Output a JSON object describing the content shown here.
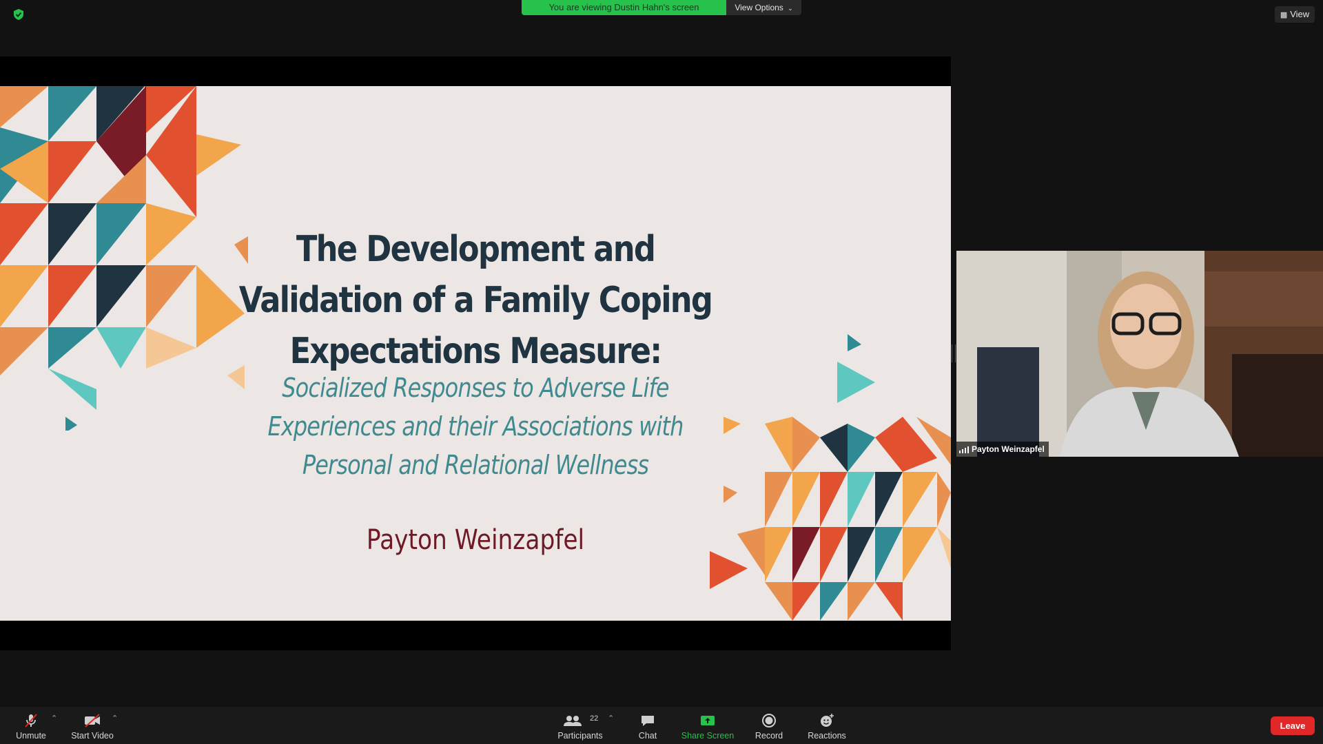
{
  "banner": {
    "text": "You are viewing Dustin Hahn's screen",
    "color": "#27c24c"
  },
  "view_options": {
    "label": "View Options",
    "icon": "chevron-down-icon"
  },
  "view_button": {
    "label": "View",
    "icon": "view-layout-icon"
  },
  "security": {
    "icon": "shield-check-icon",
    "color": "#27c24c"
  },
  "slide": {
    "title_lines": [
      "The Development and",
      "Validation of a Family Coping",
      "Expectations Measure:"
    ],
    "subtitle_lines": [
      "Socialized Responses to Adverse Life",
      "Experiences and their Associations with",
      "Personal and Relational Wellness"
    ],
    "author": "Payton Weinzapfel",
    "colors": {
      "background": "#ece6e5",
      "title": "#1f3340",
      "subtitle": "#3e8a8f",
      "author": "#6e1a26"
    }
  },
  "video": {
    "participant_name": "Payton Weinzapfel",
    "signal_icon": "signal-bars-icon"
  },
  "toolbar": {
    "unmute_label": "Unmute",
    "start_video_label": "Start Video",
    "participants_label": "Participants",
    "participants_count": "22",
    "chat_label": "Chat",
    "share_screen_label": "Share Screen",
    "record_label": "Record",
    "reactions_label": "Reactions",
    "leave_label": "Leave",
    "share_color": "#27c24c",
    "leave_color": "#e02828"
  }
}
